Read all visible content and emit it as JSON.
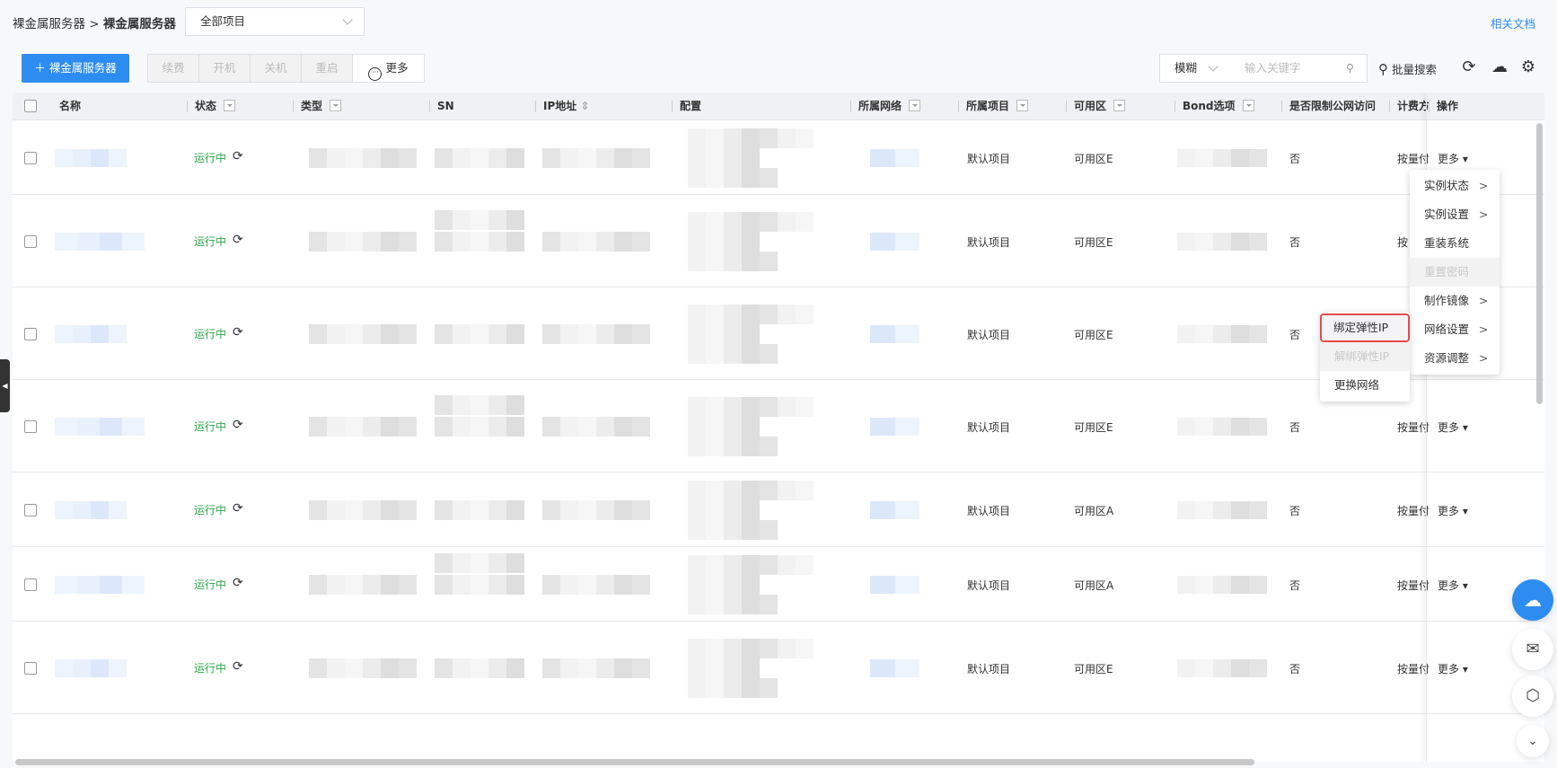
{
  "breadcrumb": {
    "parent": "裸金属服务器",
    "separator": " > ",
    "current": "裸金属服务器"
  },
  "project_select": {
    "value": "全部项目"
  },
  "docs_link": "相关文档",
  "toolbar": {
    "new_button": "＋ 裸金属服务器",
    "renew": "续费",
    "power_on": "开机",
    "power_off": "关机",
    "reboot": "重启",
    "more": "更多"
  },
  "search": {
    "mode": "模糊",
    "placeholder": "输入关键字",
    "bulk_search": "批量搜索"
  },
  "icons": {
    "refresh": "refresh-icon",
    "download": "cloud-download-icon",
    "settings": "gear-icon"
  },
  "columns": [
    "名称",
    "状态",
    "类型",
    "SN",
    "IP地址",
    "配置",
    "所属网络",
    "所属项目",
    "可用区",
    "Bond选项",
    "是否限制公网访问",
    "计费方",
    "操作"
  ],
  "rows": [
    {
      "status": "运行中",
      "project": "默认项目",
      "zone": "可用区E",
      "public_limit": "否",
      "billing": "按量付",
      "action": "更多"
    },
    {
      "status": "运行中",
      "project": "默认项目",
      "zone": "可用区E",
      "public_limit": "否",
      "billing": "按",
      "action": ""
    },
    {
      "status": "运行中",
      "project": "默认项目",
      "zone": "可用区E",
      "public_limit": "否",
      "billing": "",
      "action": ""
    },
    {
      "status": "运行中",
      "project": "默认项目",
      "zone": "可用区E",
      "public_limit": "否",
      "billing": "按量付",
      "action": "更多"
    },
    {
      "status": "运行中",
      "project": "默认项目",
      "zone": "可用区A",
      "public_limit": "否",
      "billing": "按量付",
      "action": "更多"
    },
    {
      "status": "运行中",
      "project": "默认项目",
      "zone": "可用区A",
      "public_limit": "否",
      "billing": "按量付",
      "action": "更多"
    },
    {
      "status": "运行中",
      "project": "默认项目",
      "zone": "可用区E",
      "public_limit": "否",
      "billing": "按量付",
      "action": "更多"
    }
  ],
  "action_menu": [
    {
      "label": "实例状态",
      "sub": true,
      "disabled": false
    },
    {
      "label": "实例设置",
      "sub": true,
      "disabled": false
    },
    {
      "label": "重装系统",
      "sub": false,
      "disabled": false
    },
    {
      "label": "重置密码",
      "sub": false,
      "disabled": true
    },
    {
      "label": "制作镜像",
      "sub": true,
      "disabled": false
    },
    {
      "label": "网络设置",
      "sub": true,
      "disabled": false
    },
    {
      "label": "资源调整",
      "sub": true,
      "disabled": false
    }
  ],
  "network_submenu": [
    {
      "label": "绑定弹性IP",
      "disabled": false,
      "highlighted": true
    },
    {
      "label": "解绑弹性IP",
      "disabled": true
    },
    {
      "label": "更换网络",
      "disabled": false
    }
  ],
  "colors": {
    "primary": "#2d8cf0",
    "running": "#2aa84a",
    "highlight_border": "#e84a4a"
  }
}
